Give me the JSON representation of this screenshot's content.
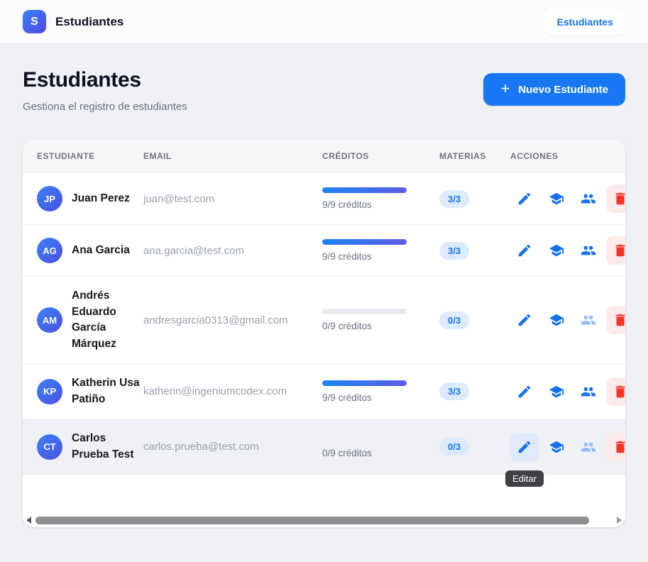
{
  "header": {
    "logo_letter": "S",
    "app_title": "Estudiantes",
    "nav_item": "Estudiantes"
  },
  "page": {
    "title": "Estudiantes",
    "subtitle": "Gestiona el registro de estudiantes",
    "new_student_button": "Nuevo Estudiante",
    "plus_icon": "+"
  },
  "table": {
    "columns": [
      "Estudiante",
      "Email",
      "Créditos",
      "Materias",
      "Acciones"
    ],
    "rows": [
      {
        "initials": "JP",
        "name": "Juan Perez",
        "email": "juan@test.com",
        "credits_text": "9/9 créditos",
        "credits_percent": 100,
        "materias_badge": "3/3",
        "enroll_enabled": true,
        "highlighted": false,
        "edit_hovered": false,
        "show_progress_track": true
      },
      {
        "initials": "AG",
        "name": "Ana Garcia",
        "email": "ana.garcia@test.com",
        "credits_text": "9/9 créditos",
        "credits_percent": 100,
        "materias_badge": "3/3",
        "enroll_enabled": true,
        "highlighted": false,
        "edit_hovered": false,
        "show_progress_track": true
      },
      {
        "initials": "AM",
        "name": "Andrés Eduardo García Márquez",
        "email": "andresgarcia0313@gmail.com",
        "credits_text": "0/9 créditos",
        "credits_percent": 0,
        "materias_badge": "0/3",
        "enroll_enabled": false,
        "highlighted": false,
        "edit_hovered": false,
        "show_progress_track": true
      },
      {
        "initials": "KP",
        "name": "Katherin Usa Patiño",
        "email": "katherin@ingeniumcodex.com",
        "credits_text": "9/9 créditos",
        "credits_percent": 100,
        "materias_badge": "3/3",
        "enroll_enabled": true,
        "highlighted": false,
        "edit_hovered": false,
        "show_progress_track": true
      },
      {
        "initials": "CT",
        "name": "Carlos Prueba Test",
        "email": "carlos.prueba@test.com",
        "credits_text": "0/9 créditos",
        "credits_percent": 0,
        "materias_badge": "0/3",
        "enroll_enabled": false,
        "highlighted": true,
        "edit_hovered": true,
        "show_progress_track": false
      }
    ]
  },
  "tooltip": {
    "edit_label": "Editar"
  },
  "icons": {
    "logo": "letter-S-square",
    "plus": "plus-icon",
    "edit": "pencil-icon",
    "subjects": "graduation-cap-icon",
    "enroll": "people-icon",
    "delete": "trash-icon",
    "scroll_left": "left-triangle-icon",
    "scroll_right": "right-triangle-icon"
  },
  "colors": {
    "accent_blue": "#1877f2",
    "icon_blue": "#1a73e8",
    "badge_bg": "#dcebfd",
    "progress_gradient_start": "#1b84f5",
    "progress_gradient_end": "#5e5ce6",
    "danger_red": "#f23527",
    "danger_bg": "#fdeaea",
    "tooltip_bg": "#3f3f46"
  }
}
